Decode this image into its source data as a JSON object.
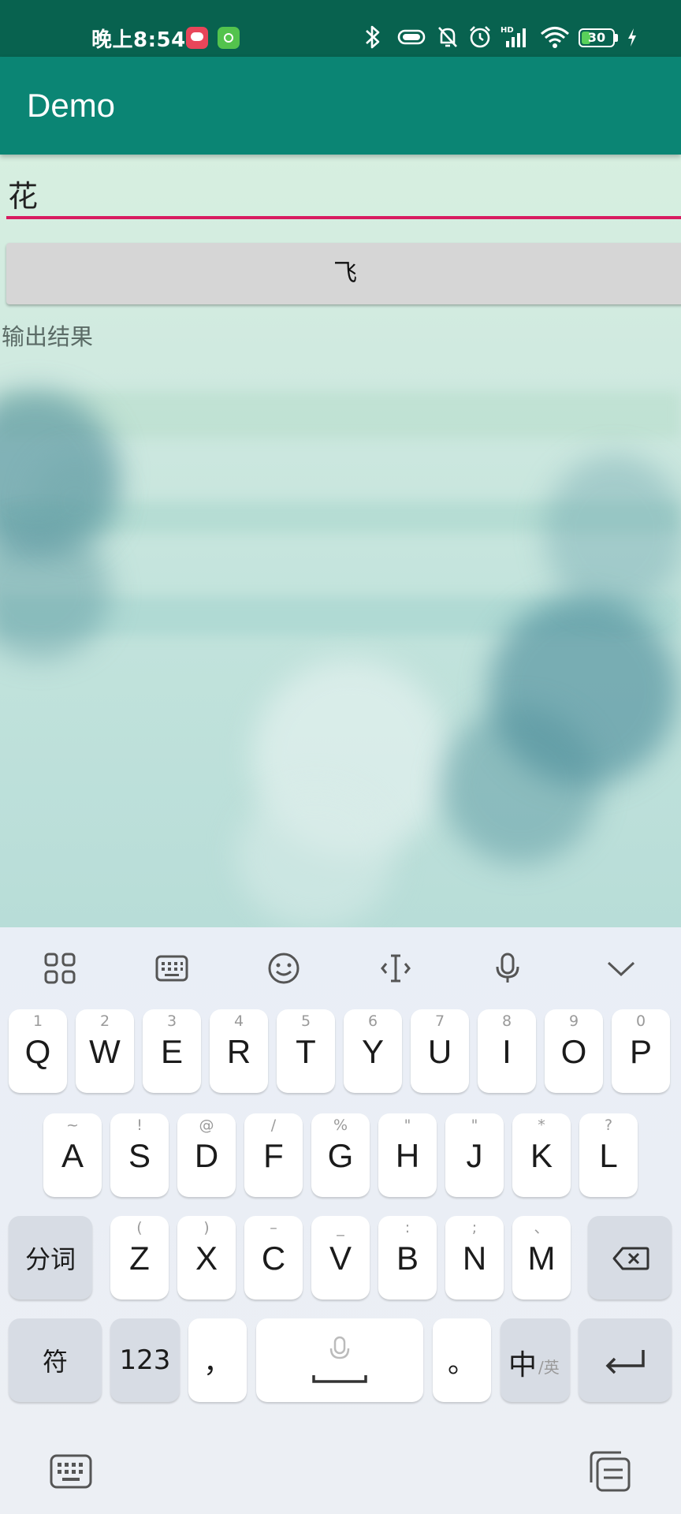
{
  "status_bar": {
    "time": "晚上8:54",
    "battery_level": "30",
    "battery_fraction": 0.3,
    "icons": [
      "bluetooth-icon",
      "vibrate-icon",
      "mute-icon",
      "alarm-icon",
      "hd-signal-icon",
      "wifi-icon",
      "battery-icon",
      "charging-icon"
    ]
  },
  "app_bar": {
    "title": "Demo"
  },
  "main": {
    "input_value": "花",
    "button_label": "飞",
    "output_text": "输出结果"
  },
  "colors": {
    "status_bar": "#08624f",
    "app_bar": "#0b8574",
    "input_underline": "#d81b60",
    "button": "#d6d6d6"
  },
  "keyboard": {
    "toolbar": [
      "grid-icon",
      "keyboard-icon",
      "emoji-icon",
      "cursor-icon",
      "microphone-icon",
      "collapse-icon"
    ],
    "row1": [
      {
        "hint": "1",
        "label": "Q"
      },
      {
        "hint": "2",
        "label": "W"
      },
      {
        "hint": "3",
        "label": "E"
      },
      {
        "hint": "4",
        "label": "R"
      },
      {
        "hint": "5",
        "label": "T"
      },
      {
        "hint": "6",
        "label": "Y"
      },
      {
        "hint": "7",
        "label": "U"
      },
      {
        "hint": "8",
        "label": "I"
      },
      {
        "hint": "9",
        "label": "O"
      },
      {
        "hint": "0",
        "label": "P"
      }
    ],
    "row2": [
      {
        "hint": "~",
        "label": "A"
      },
      {
        "hint": "!",
        "label": "S"
      },
      {
        "hint": "@",
        "label": "D"
      },
      {
        "hint": "/",
        "label": "F"
      },
      {
        "hint": "%",
        "label": "G"
      },
      {
        "hint": "\"",
        "label": "H"
      },
      {
        "hint": "\"",
        "label": "J"
      },
      {
        "hint": "*",
        "label": "K"
      },
      {
        "hint": "?",
        "label": "L"
      }
    ],
    "row3": [
      {
        "hint": "(",
        "label": "Z"
      },
      {
        "hint": ")",
        "label": "X"
      },
      {
        "hint": "–",
        "label": "C"
      },
      {
        "hint": "_",
        "label": "V"
      },
      {
        "hint": ":",
        "label": "B"
      },
      {
        "hint": ";",
        "label": "N"
      },
      {
        "hint": "、",
        "label": "M"
      }
    ],
    "segment_label": "分词",
    "symbol_label": "符",
    "numbers_label": "123",
    "comma_label": "，",
    "period_label": "。",
    "lang_label": "中",
    "lang_alt_label": "/英"
  }
}
